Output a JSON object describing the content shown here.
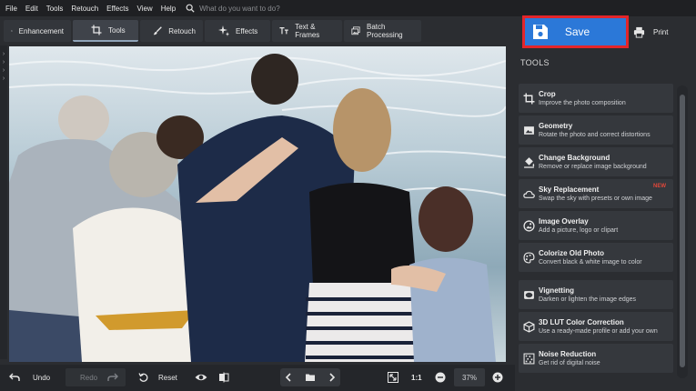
{
  "menu": [
    "File",
    "Edit",
    "Tools",
    "Retouch",
    "Effects",
    "View",
    "Help"
  ],
  "search": {
    "placeholder": "What do you want to do?"
  },
  "tabs": [
    {
      "label": "Enhancement",
      "icon": "sliders-icon"
    },
    {
      "label": "Tools",
      "icon": "crop-icon",
      "active": true
    },
    {
      "label": "Retouch",
      "icon": "brush-icon"
    },
    {
      "label": "Effects",
      "icon": "sparkle-icon"
    },
    {
      "label": "Text & Frames",
      "icon": "text-icon"
    },
    {
      "label": "Batch Processing",
      "icon": "images-icon"
    }
  ],
  "save": {
    "label": "Save",
    "color": "#2b78d8",
    "highlight": "#e3252a"
  },
  "print": {
    "label": "Print"
  },
  "tools_panel": {
    "title": "TOOLS",
    "items": [
      {
        "name": "Crop",
        "desc": "Improve the photo composition",
        "icon": "crop-icon"
      },
      {
        "name": "Geometry",
        "desc": "Rotate the photo and correct distortions",
        "icon": "geometry-icon"
      },
      {
        "name": "Change Background",
        "desc": "Remove or replace image background",
        "icon": "bucket-icon"
      },
      {
        "name": "Sky Replacement",
        "desc": "Swap the sky with presets or own image",
        "icon": "cloud-icon",
        "badge": "NEW"
      },
      {
        "name": "Image Overlay",
        "desc": "Add a picture, logo or clipart",
        "icon": "overlay-icon"
      },
      {
        "name": "Colorize Old Photo",
        "desc": "Convert black & white image to color",
        "icon": "palette-icon"
      },
      {
        "name": "Vignetting",
        "desc": "Darken or lighten the image edges",
        "icon": "vignette-icon"
      },
      {
        "name": "3D LUT Color Correction",
        "desc": "Use a ready-made profile or add your own",
        "icon": "cube-icon"
      },
      {
        "name": "Noise Reduction",
        "desc": "Get rid of digital noise",
        "icon": "noise-icon"
      }
    ]
  },
  "bottom": {
    "undo": "Undo",
    "redo": "Redo",
    "reset": "Reset",
    "one_to_one": "1:1",
    "zoom": "37%"
  },
  "colors": {
    "accent": "#2b78d8",
    "badge": "#e0473a",
    "panel": "#35383d",
    "background": "#2b2d31"
  }
}
